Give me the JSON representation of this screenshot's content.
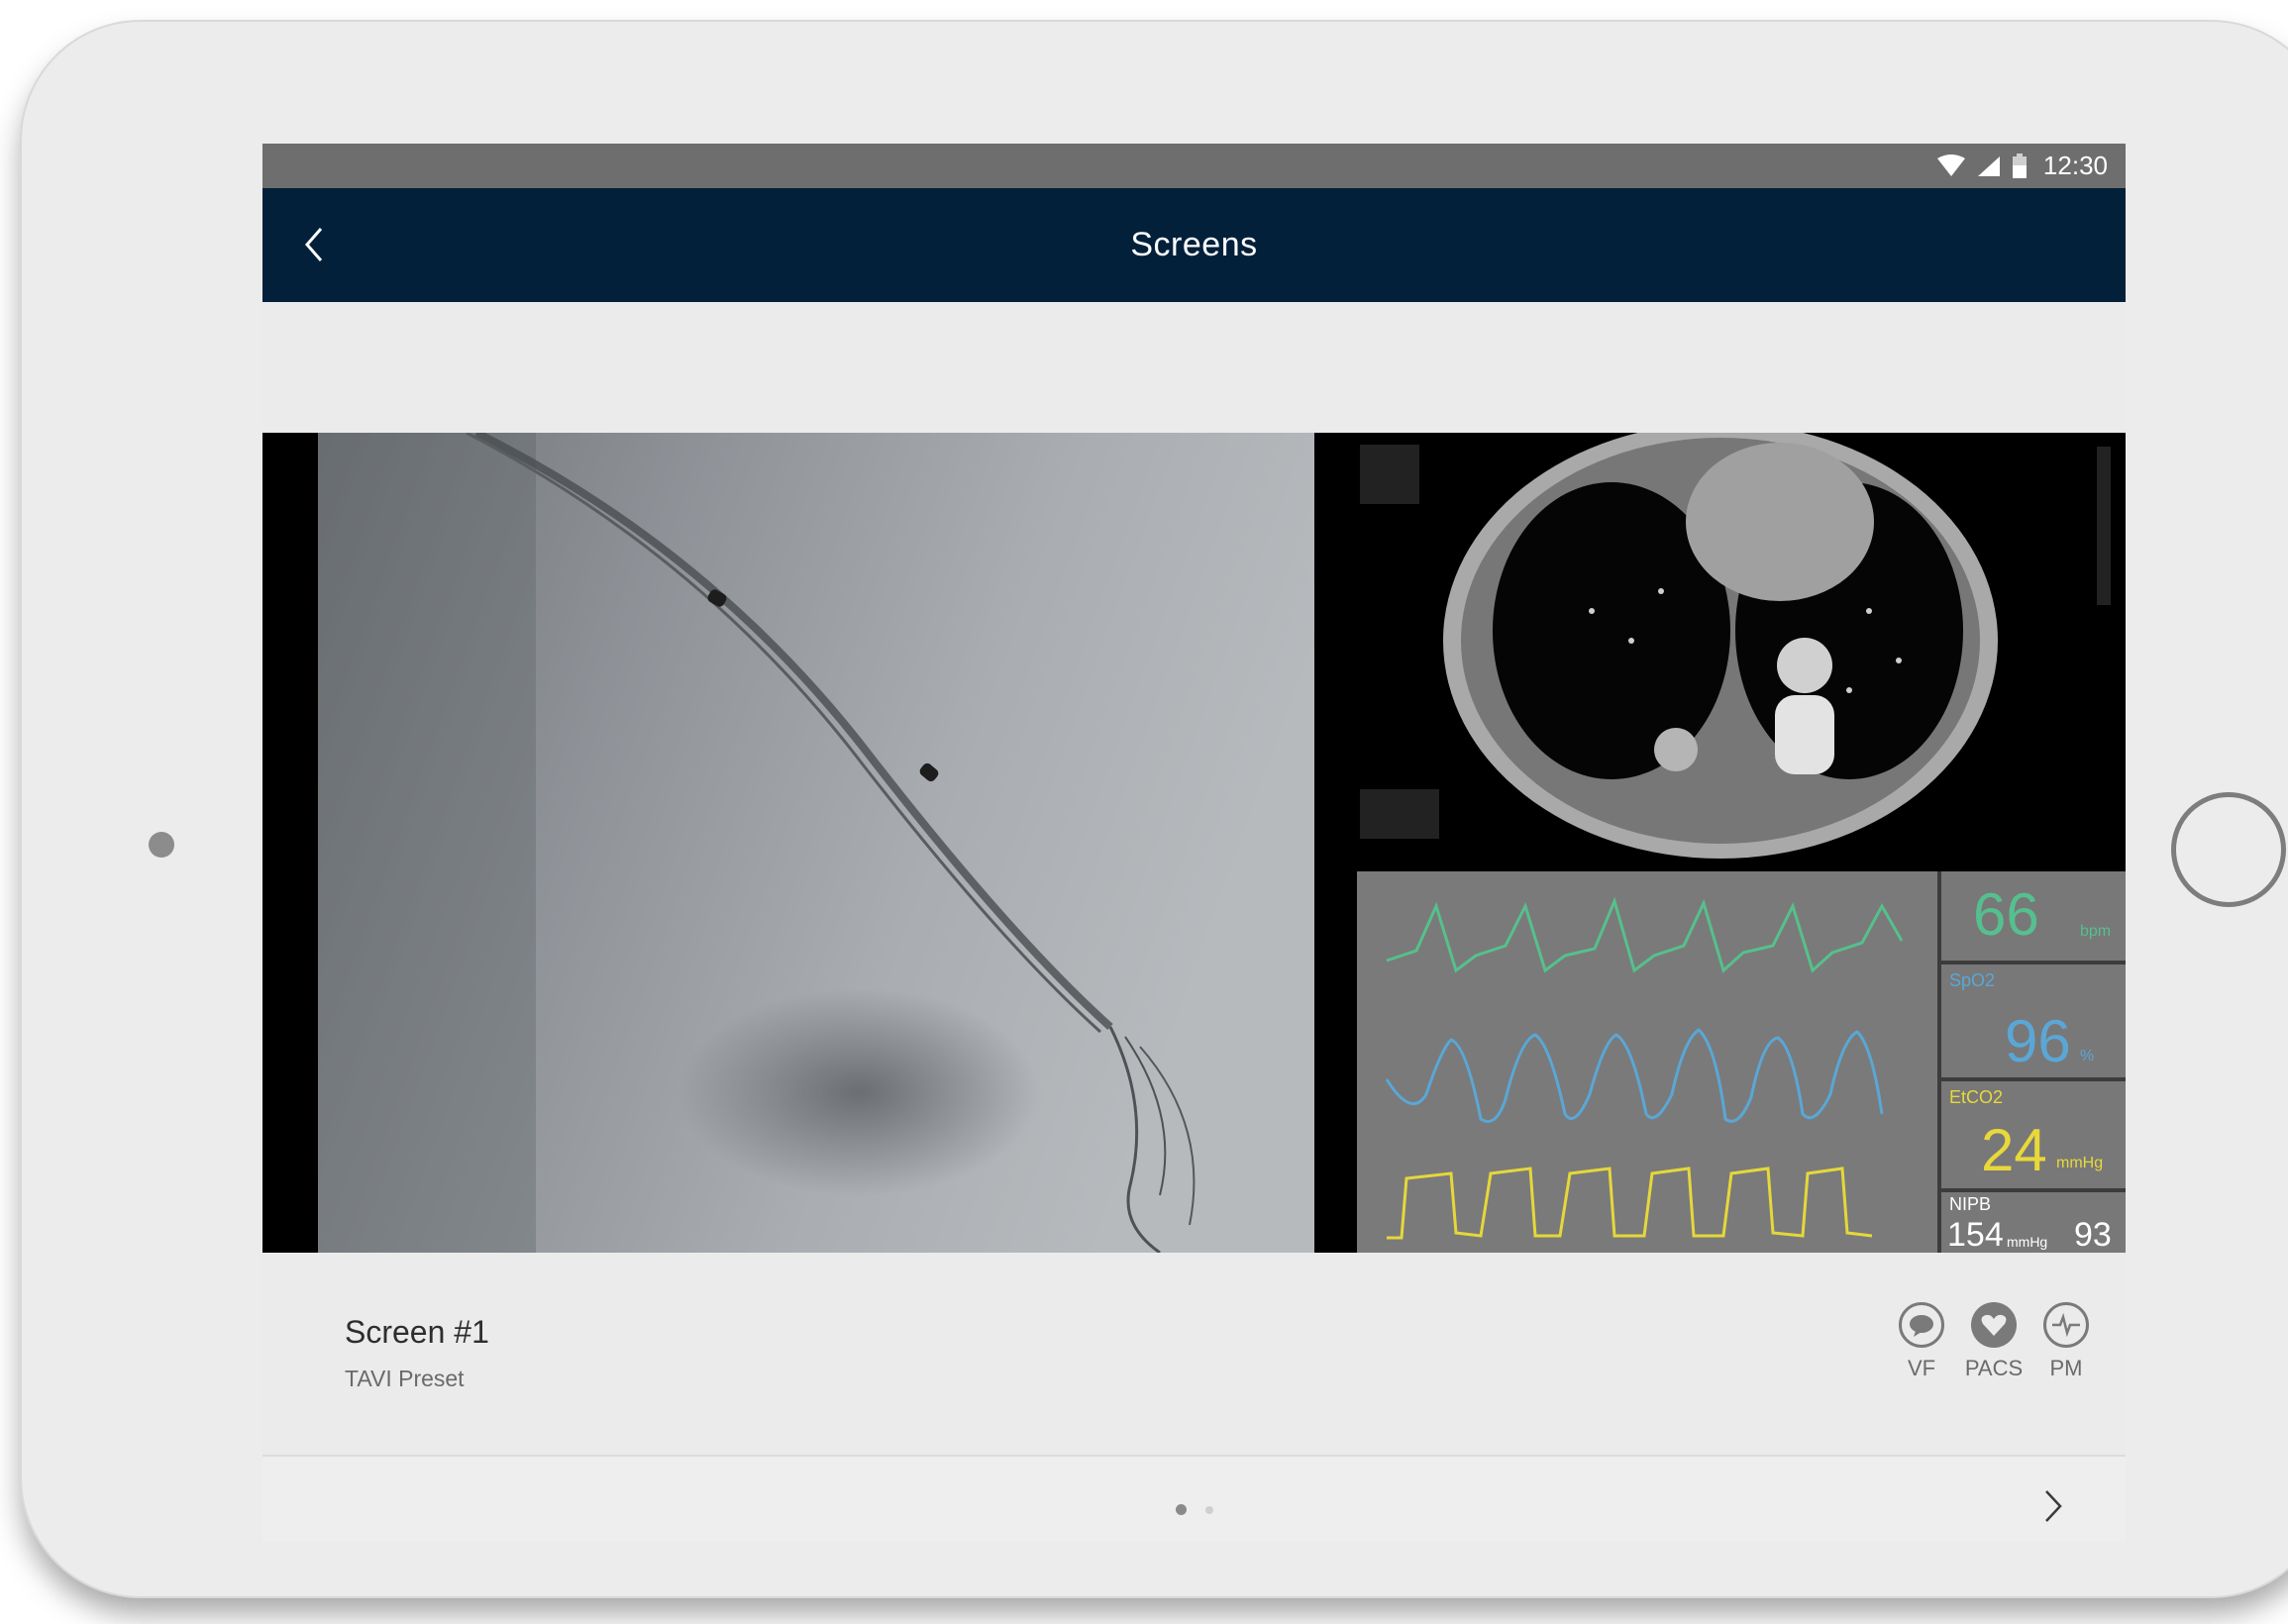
{
  "status_bar": {
    "time": "12:30",
    "icons": [
      "wifi-icon",
      "signal-icon",
      "battery-icon"
    ]
  },
  "app_bar": {
    "title": "Screens",
    "back_icon": "chevron-left-icon"
  },
  "screen_card": {
    "name": "Screen #1",
    "preset": "TAVI Preset",
    "sources": [
      {
        "label": "VF",
        "icon": "video-feed-icon"
      },
      {
        "label": "PACS",
        "icon": "heart-icon"
      },
      {
        "label": "PM",
        "icon": "ecg-icon"
      }
    ]
  },
  "monitor": {
    "heart_rate": {
      "value": "66",
      "unit": "bpm",
      "color": "#55c08f"
    },
    "spo2": {
      "label": "SpO2",
      "value": "96",
      "unit": "%",
      "color": "#5aa7d6"
    },
    "etco2": {
      "label": "EtCO2",
      "value": "24",
      "unit": "mmHg",
      "color": "#e8d83a"
    },
    "nibp": {
      "label": "NIPB",
      "systolic": "154",
      "unit": "mmHg",
      "diastolic": "93",
      "color": "#ffffff"
    }
  },
  "pager": {
    "pages": 2,
    "current": 1,
    "next_icon": "chevron-right-icon"
  },
  "colors": {
    "app_bar": "#03203a",
    "status_bar": "#6e6e6e",
    "background": "#ebebeb"
  }
}
